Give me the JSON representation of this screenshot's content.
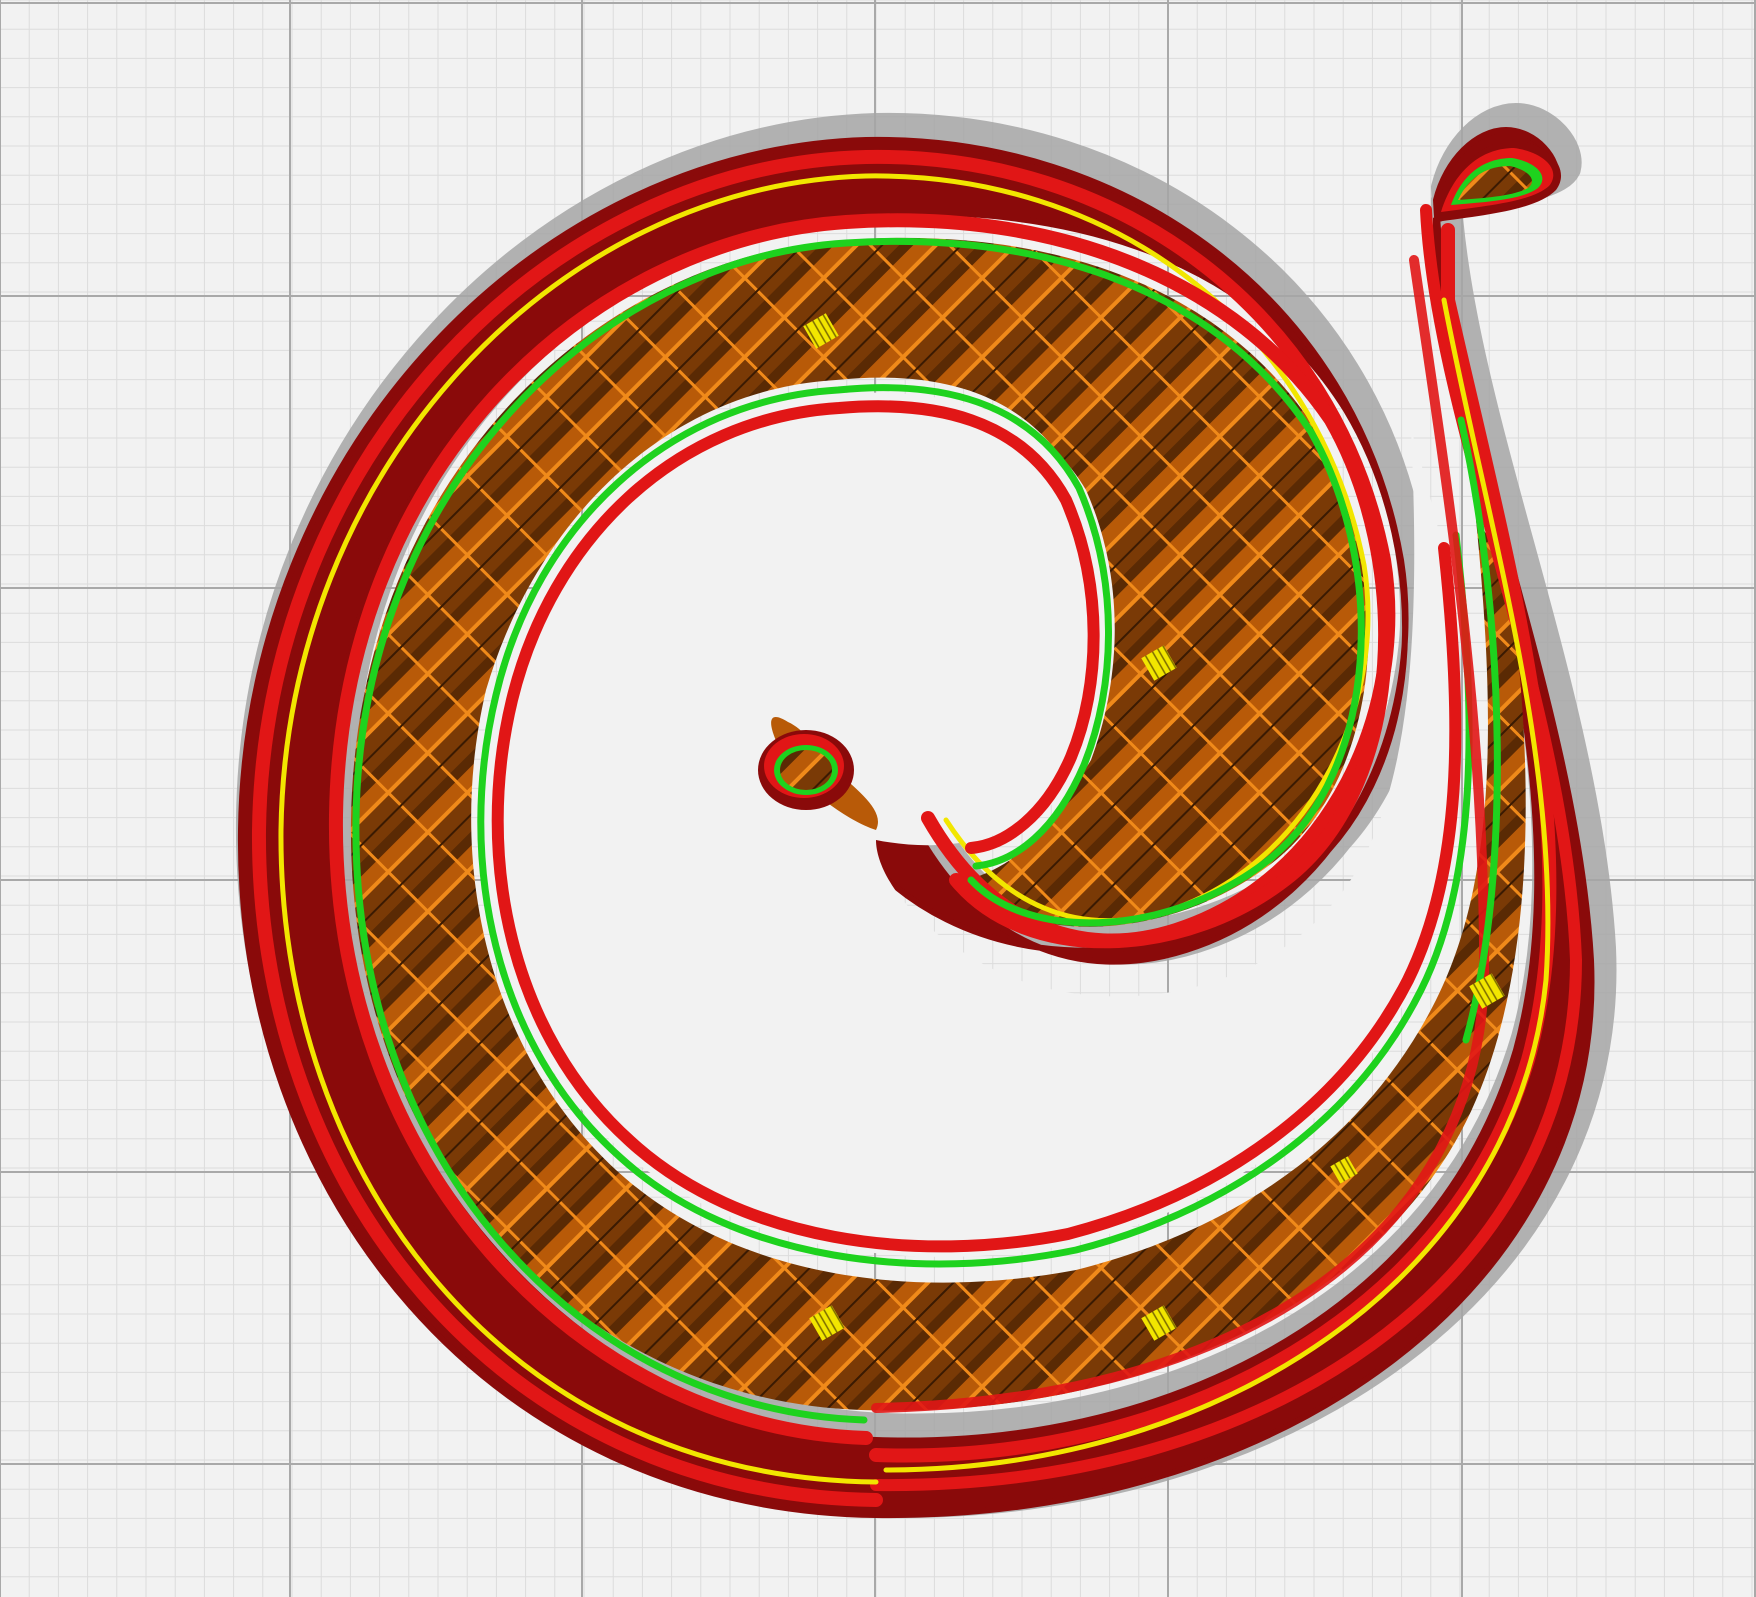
{
  "view": {
    "type": "slicer-layer-preview",
    "subject": "spiral"
  },
  "legend_colors": {
    "background": "#f2f2f2",
    "grid_major": "#a9a9a9",
    "grid_minor": "#dcdcdc",
    "shadow": "#a6a6a6",
    "outer_wall_dark": "#8a0a0a",
    "outer_wall": "#e11616",
    "skin_line": "#f2e600",
    "inner_wall": "#1ed21e",
    "infill_dark": "#5a2a04",
    "infill_mid": "#b85a08",
    "infill_light": "#f08a1a",
    "marker": "#f2e600"
  },
  "features": [
    {
      "name": "outer-wall",
      "color_key": "outer_wall"
    },
    {
      "name": "inner-wall",
      "color_key": "inner_wall"
    },
    {
      "name": "skin",
      "color_key": "skin_line"
    },
    {
      "name": "infill",
      "color_key": "infill_mid"
    },
    {
      "name": "shadow",
      "color_key": "shadow"
    }
  ]
}
